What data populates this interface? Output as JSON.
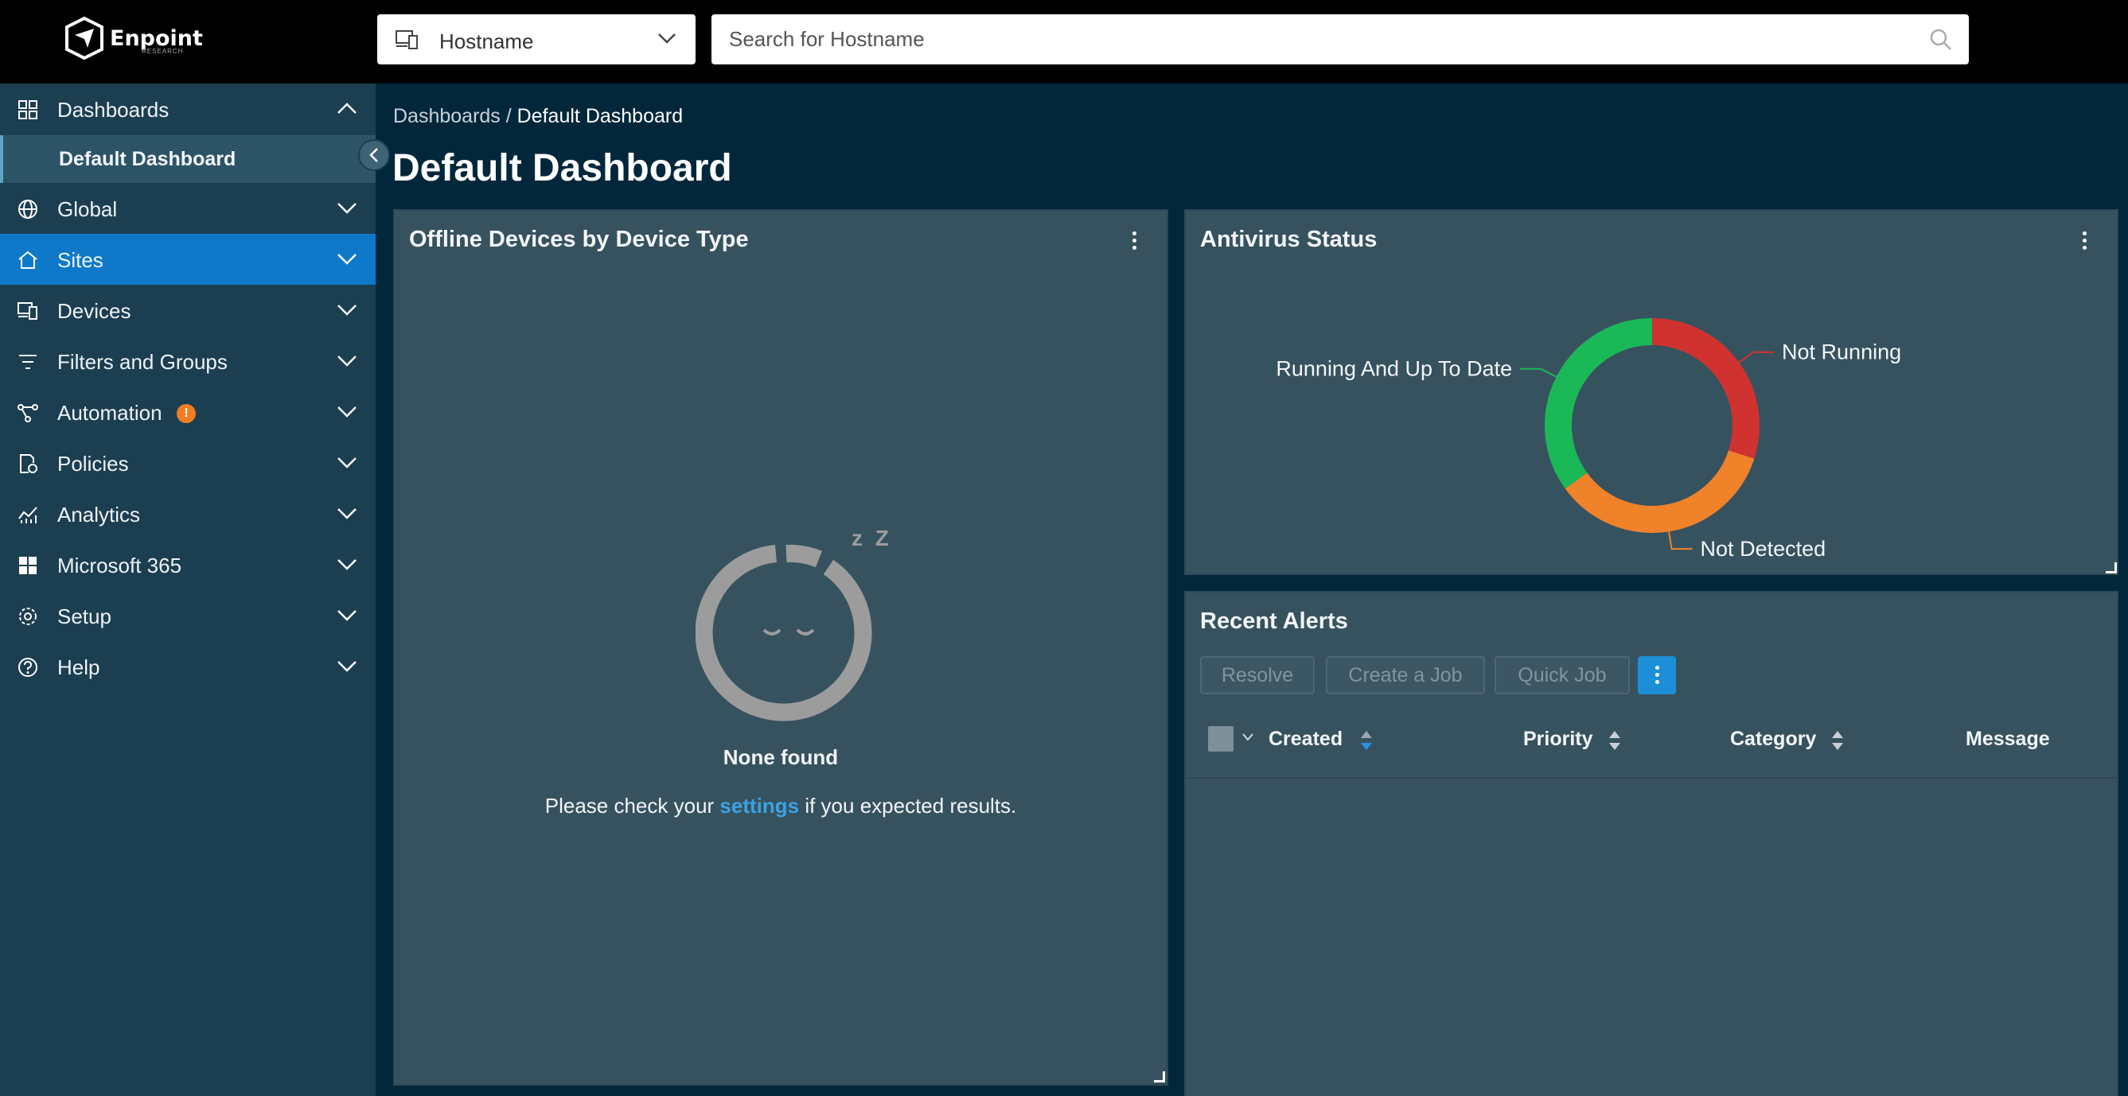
{
  "header": {
    "logo_text": "Enpoint",
    "logo_subtext": "RESEARCH",
    "host_select": "Hostname",
    "search_placeholder": "Search for Hostname"
  },
  "sidebar": {
    "items": [
      {
        "label": "Dashboards",
        "icon": "grid-icon"
      },
      {
        "label": "Global",
        "icon": "globe-icon"
      },
      {
        "label": "Sites",
        "icon": "home-icon"
      },
      {
        "label": "Devices",
        "icon": "devices-icon"
      },
      {
        "label": "Filters and Groups",
        "icon": "filter-icon"
      },
      {
        "label": "Automation",
        "icon": "workflow-icon",
        "badge": "!"
      },
      {
        "label": "Policies",
        "icon": "policy-icon"
      },
      {
        "label": "Analytics",
        "icon": "analytics-icon"
      },
      {
        "label": "Microsoft 365",
        "icon": "windows-icon"
      },
      {
        "label": "Setup",
        "icon": "gear-icon"
      },
      {
        "label": "Help",
        "icon": "help-icon"
      }
    ],
    "sub_item": "Default Dashboard",
    "active": "Sites"
  },
  "breadcrumb": {
    "parent": "Dashboards",
    "separator": " / ",
    "current": "Default Dashboard"
  },
  "page_title": "Default Dashboard",
  "offline_card": {
    "title": "Offline Devices by Device Type",
    "empty_title": "None found",
    "empty_pre": "Please check your ",
    "empty_link": "settings",
    "empty_post": " if you expected results.",
    "sleep_text": "z Z"
  },
  "antivirus_card": {
    "title": "Antivirus Status"
  },
  "chart_data": {
    "type": "pie",
    "title": "Antivirus Status",
    "categories": [
      "Not Running",
      "Not Detected",
      "Running And Up To Date"
    ],
    "values": [
      30,
      35,
      35
    ],
    "colors": [
      "#d0322f",
      "#f0822a",
      "#1bb857"
    ]
  },
  "alerts_card": {
    "title": "Recent Alerts",
    "buttons": {
      "resolve": "Resolve",
      "create_job": "Create a Job",
      "quick_job": "Quick Job"
    },
    "columns": {
      "created": "Created",
      "priority": "Priority",
      "category": "Category",
      "message": "Message"
    }
  },
  "colors": {
    "accent": "#0f79c9",
    "sidebar": "#1c3e51",
    "card": "#37525f",
    "background": "#02273b",
    "link": "#3aa3e4",
    "badge": "#f07d22"
  }
}
